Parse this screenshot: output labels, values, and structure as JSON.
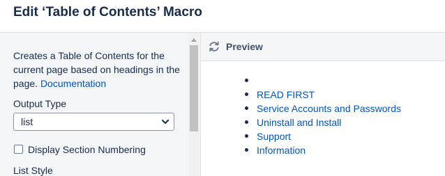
{
  "dialog": {
    "title": "Edit ‘Table of Contents’ Macro"
  },
  "settings": {
    "description": "Creates a Table of Contents for the current page based on headings in the page.",
    "documentation_link": "Documentation",
    "output_type_label": "Output Type",
    "output_type_value": "list",
    "section_numbering_label": "Display Section Numbering",
    "section_numbering_checked": false,
    "list_style_label": "List Style"
  },
  "preview": {
    "title": "Preview",
    "refresh_icon": "refresh-icon",
    "items": [
      {
        "label": ""
      },
      {
        "label": "READ FIRST"
      },
      {
        "label": "Service Accounts and Passwords"
      },
      {
        "label": "Uninstall and Install"
      },
      {
        "label": "Support"
      },
      {
        "label": "Information"
      }
    ]
  },
  "colors": {
    "link": "#0052cc",
    "text": "#172b4d",
    "panel_bg": "#f4f5f7"
  }
}
